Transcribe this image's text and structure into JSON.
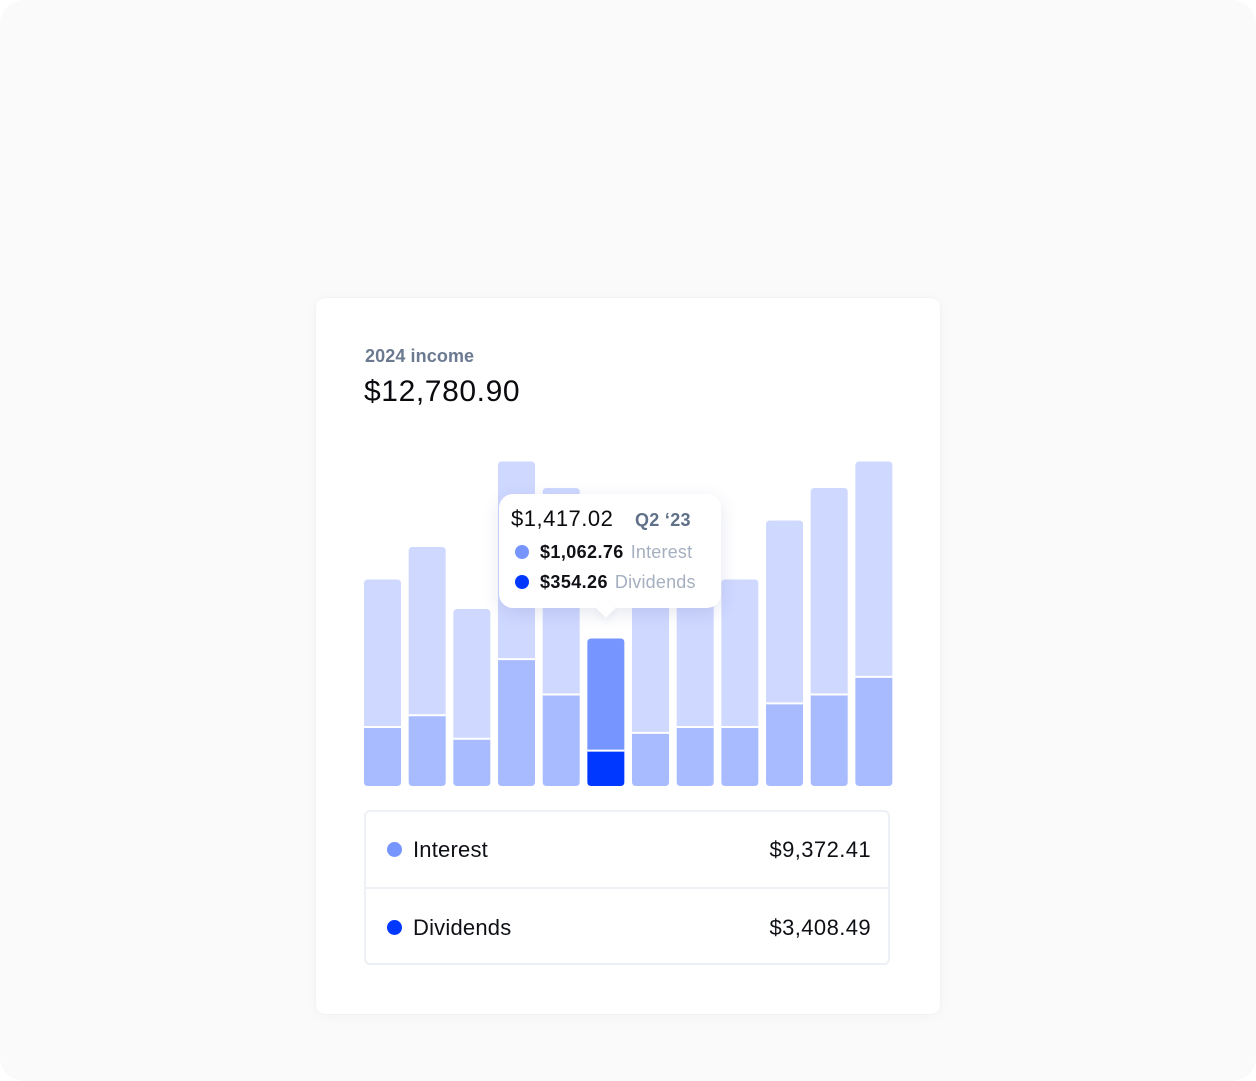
{
  "header": {
    "title": "2024 income",
    "total": "$12,780.90"
  },
  "colors": {
    "background": "#fafafa",
    "card": "#ffffff",
    "interest": "#7695ff",
    "dividends": "#0038ff",
    "interest_muted": "#a8bbff",
    "remainder_muted": "#cfd8ff",
    "text_primary": "#0e1016",
    "text_secondary": "#6b7a90",
    "text_muted": "#a4afbf",
    "divider": "#edf0f4"
  },
  "tooltip": {
    "total": "$1,417.02",
    "period": "Q2 ‘23",
    "items": [
      {
        "value": "$1,062.76",
        "label": "Interest",
        "color": "#7695ff"
      },
      {
        "value": "$354.26",
        "label": "Dividends",
        "color": "#0038ff"
      }
    ]
  },
  "legend": {
    "items": [
      {
        "label": "Interest",
        "value": "$9,372.41",
        "color": "#7695ff"
      },
      {
        "label": "Dividends",
        "value": "$3,408.49",
        "color": "#0038ff"
      }
    ]
  },
  "chart_data": {
    "type": "bar",
    "stacked": true,
    "highlighted_index": 5,
    "ylim": [
      0,
      12
    ],
    "grid": false,
    "bars": [
      {
        "lower": 2.0,
        "total": 7.0
      },
      {
        "lower": 2.4,
        "total": 8.1
      },
      {
        "lower": 1.6,
        "total": 6.0
      },
      {
        "lower": 4.3,
        "total": 11.0
      },
      {
        "lower": 3.1,
        "total": 10.1
      },
      {
        "lower": 1.2,
        "total": 5.0
      },
      {
        "lower": 1.8,
        "total": 7.6
      },
      {
        "lower": 2.0,
        "total": 7.2
      },
      {
        "lower": 2.0,
        "total": 7.0
      },
      {
        "lower": 2.8,
        "total": 9.0
      },
      {
        "lower": 3.1,
        "total": 10.1
      },
      {
        "lower": 3.7,
        "total": 11.0
      }
    ]
  }
}
